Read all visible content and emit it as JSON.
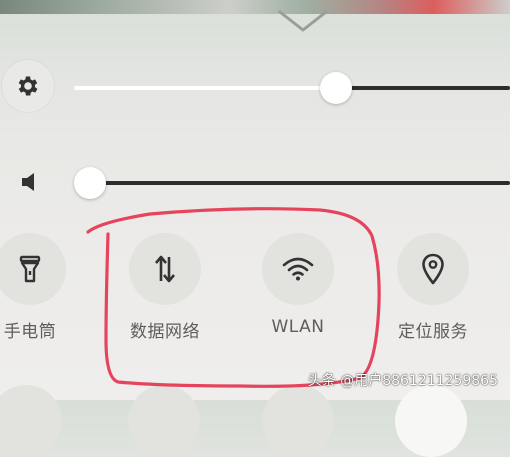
{
  "panel": {
    "brightness": {
      "icon": "gear-icon",
      "level": 0.61
    },
    "volume": {
      "icon": "speaker-icon",
      "level": 0.0
    }
  },
  "tiles": [
    {
      "id": "flashlight",
      "label": "手电筒",
      "icon": "flashlight-icon"
    },
    {
      "id": "mobile-data",
      "label": "数据网络",
      "icon": "data-arrows-icon"
    },
    {
      "id": "wlan",
      "label": "WLAN",
      "icon": "wifi-icon"
    },
    {
      "id": "location",
      "label": "定位服务",
      "icon": "location-pin-icon"
    }
  ],
  "annotation": {
    "color": "#e5445d"
  },
  "watermark": {
    "text": "头条 @用户8861211259865"
  },
  "colors": {
    "track_active": "#ffffff",
    "track_inactive": "#2d2d2d",
    "icon": "#333333"
  }
}
